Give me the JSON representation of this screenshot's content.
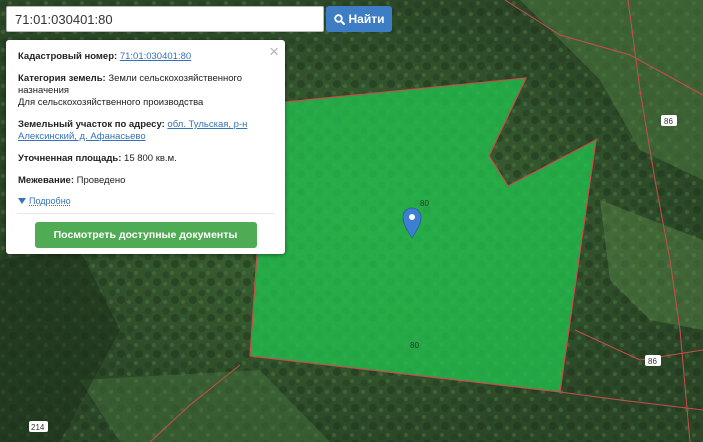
{
  "search": {
    "query": "71:01:030401:80",
    "button_label": "Найти"
  },
  "card": {
    "cadastral_label": "Кадастровый номер:",
    "cadastral_value": "71:01:030401:80",
    "category_label": "Категория земель:",
    "category_value": "Земли сельскохозяйственного назначения",
    "purpose_value": "Для сельскохозяйственного производства",
    "address_label": "Земельный участок по адресу:",
    "address_value": "обл. Тульская, р-н Алексинский, д. Афанасьево",
    "area_label": "Уточненная площадь:",
    "area_value": "15 800 кв.м.",
    "survey_label": "Межевание:",
    "survey_value": "Проведено",
    "more_label": "Подробно",
    "docs_button_label": "Посмотреть доступные документы"
  },
  "map": {
    "labels": {
      "parcel_center": "80",
      "parcel_bottom": "80",
      "right_top": "86",
      "right_bottom": "86",
      "bottom_left": "214"
    },
    "colors": {
      "parcel_fill": "#21c24e",
      "parcel_stroke": "#c94d4d",
      "pin": "#3d7fd0"
    }
  }
}
